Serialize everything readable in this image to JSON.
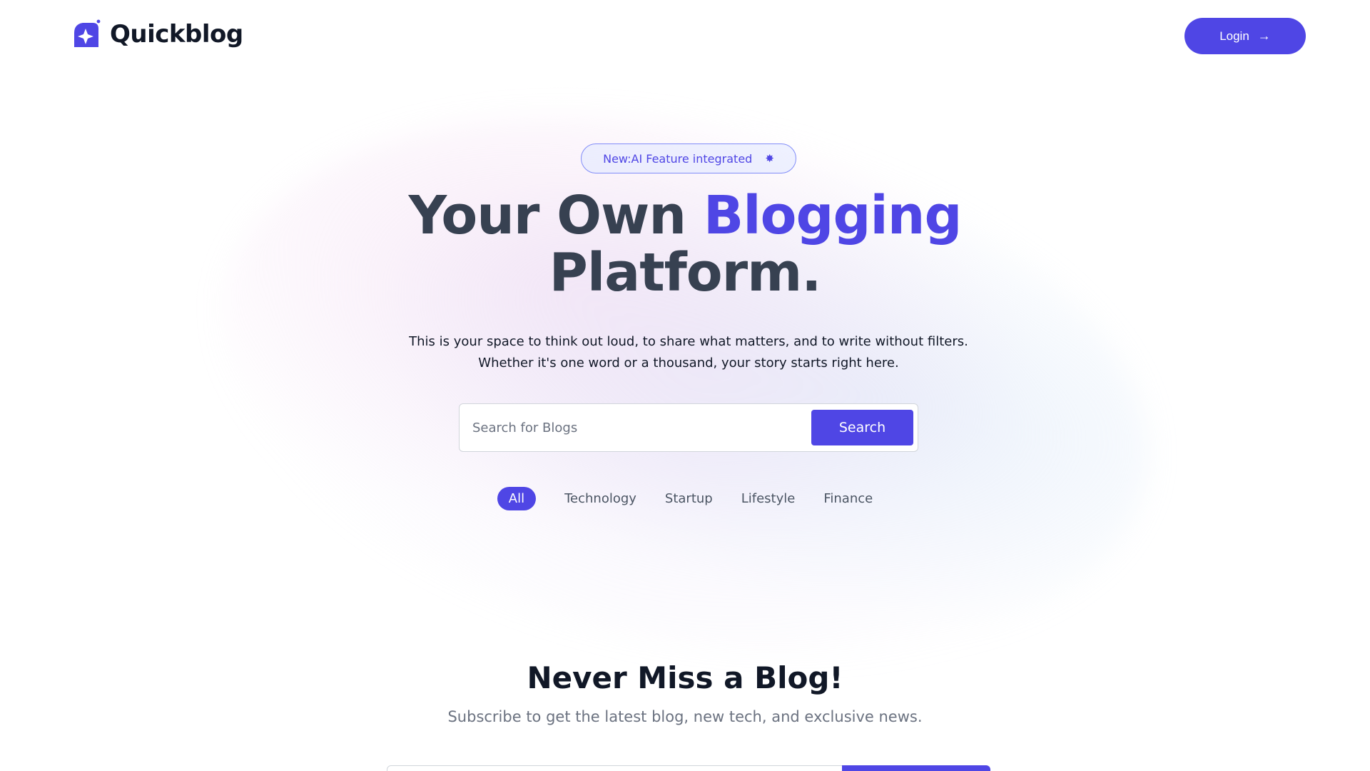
{
  "header": {
    "brand": "Quickblog",
    "login_label": "Login",
    "login_icon": "arrow-right-icon"
  },
  "hero": {
    "badge_text": "New:AI Feature integrated",
    "badge_icon": "sparkle-star-icon",
    "title_part1": "Your Own ",
    "title_accent": "Blogging",
    "title_part2": "Platform.",
    "description": "This is your space to think out loud, to share what matters, and to write without filters. Whether it's one word or a thousand, your story starts right here."
  },
  "search": {
    "placeholder": "Search for Blogs",
    "value": "",
    "button_label": "Search"
  },
  "categories": {
    "items": [
      {
        "label": "All",
        "active": true
      },
      {
        "label": "Technology",
        "active": false
      },
      {
        "label": "Startup",
        "active": false
      },
      {
        "label": "Lifestyle",
        "active": false
      },
      {
        "label": "Finance",
        "active": false
      }
    ]
  },
  "newsletter": {
    "title": "Never Miss a Blog!",
    "subtitle": "Subscribe to get the latest blog, new tech, and exclusive news."
  },
  "colors": {
    "accent": "#4f46e5",
    "title_text": "#374151",
    "muted_text": "#6b7280"
  }
}
